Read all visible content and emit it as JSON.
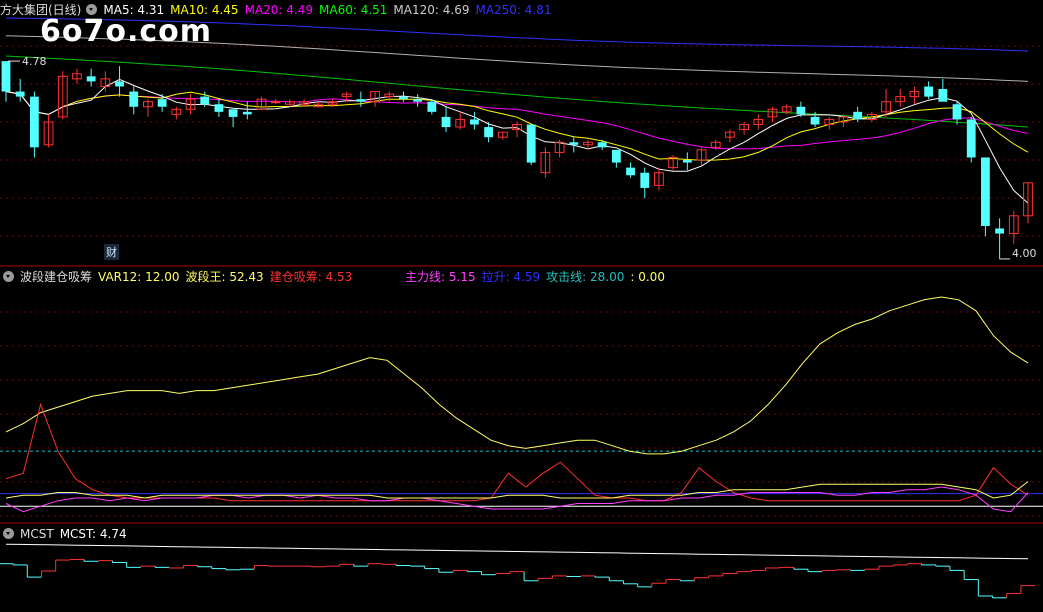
{
  "watermark": "6o7o.com",
  "panel1": {
    "title": "方大集团(日线)",
    "ma": [
      {
        "label": "MA5: 4.31",
        "color": "#ffffff"
      },
      {
        "label": "MA10: 4.45",
        "color": "#ffff00"
      },
      {
        "label": "MA20: 4.49",
        "color": "#ff00ff"
      },
      {
        "label": "MA60: 4.51",
        "color": "#00ff00"
      },
      {
        "label": "MA120: 4.69",
        "color": "#cccccc"
      },
      {
        "label": "MA250: 4.81",
        "color": "#3030ff"
      }
    ],
    "high_label": "4.78",
    "low_label": "4.00",
    "event_label": "财"
  },
  "panel2": {
    "title": "波段建仓吸筹",
    "items": [
      {
        "label": "VAR12: 12.00",
        "color": "#ffff66"
      },
      {
        "label": "波段王: 52.43",
        "color": "#ffff66"
      },
      {
        "label": "建仓吸筹: 4.53",
        "color": "#ff3030"
      }
    ],
    "items2": [
      {
        "label": "主力线: 5.15",
        "color": "#ff40ff"
      },
      {
        "label": "拉升: 4.59",
        "color": "#3030ff"
      },
      {
        "label": "攻击线: 28.00",
        "color": "#20c0c0"
      },
      {
        "label": ": 0.00",
        "color": "#ffff66"
      }
    ]
  },
  "panel3": {
    "title": "MCST",
    "items": [
      {
        "label": "MCST: 4.74",
        "color": "#ffffff"
      }
    ]
  },
  "colors": {
    "up": "#ff3232",
    "down": "#54ffff",
    "separator": "#b00000",
    "grid": "#7a0000"
  },
  "chart_data": [
    {
      "type": "candlestick",
      "title": "方大集团(日线)",
      "ylim": [
        3.98,
        4.95
      ],
      "candles": [
        [
          4.78,
          4.78,
          4.62,
          4.66
        ],
        [
          4.66,
          4.71,
          4.62,
          4.64
        ],
        [
          4.64,
          4.66,
          4.4,
          4.44
        ],
        [
          4.45,
          4.57,
          4.44,
          4.54
        ],
        [
          4.56,
          4.74,
          4.55,
          4.72
        ],
        [
          4.71,
          4.75,
          4.69,
          4.73
        ],
        [
          4.72,
          4.75,
          4.68,
          4.7
        ],
        [
          4.68,
          4.74,
          4.66,
          4.71
        ],
        [
          4.7,
          4.76,
          4.64,
          4.68
        ],
        [
          4.66,
          4.68,
          4.57,
          4.6
        ],
        [
          4.6,
          4.63,
          4.56,
          4.62
        ],
        [
          4.63,
          4.65,
          4.58,
          4.6
        ],
        [
          4.57,
          4.6,
          4.55,
          4.59
        ],
        [
          4.59,
          4.65,
          4.57,
          4.63
        ],
        [
          4.64,
          4.66,
          4.6,
          4.61
        ],
        [
          4.61,
          4.63,
          4.56,
          4.58
        ],
        [
          4.59,
          4.59,
          4.52,
          4.56
        ],
        [
          4.58,
          4.62,
          4.55,
          4.57
        ],
        [
          4.59,
          4.64,
          4.59,
          4.63
        ],
        [
          4.62,
          4.63,
          4.61,
          4.62
        ],
        [
          4.61,
          4.63,
          4.6,
          4.62
        ],
        [
          4.61,
          4.63,
          4.6,
          4.62
        ],
        [
          4.6,
          4.62,
          4.6,
          4.61
        ],
        [
          4.61,
          4.63,
          4.6,
          4.62
        ],
        [
          4.64,
          4.66,
          4.62,
          4.65
        ],
        [
          4.63,
          4.66,
          4.6,
          4.62
        ],
        [
          4.62,
          4.66,
          4.6,
          4.66
        ],
        [
          4.64,
          4.66,
          4.62,
          4.65
        ],
        [
          4.64,
          4.66,
          4.62,
          4.63
        ],
        [
          4.63,
          4.65,
          4.6,
          4.62
        ],
        [
          4.62,
          4.63,
          4.57,
          4.58
        ],
        [
          4.56,
          4.6,
          4.5,
          4.52
        ],
        [
          4.52,
          4.58,
          4.51,
          4.55
        ],
        [
          4.55,
          4.58,
          4.51,
          4.53
        ],
        [
          4.52,
          4.54,
          4.46,
          4.48
        ],
        [
          4.48,
          4.5,
          4.47,
          4.5
        ],
        [
          4.51,
          4.54,
          4.48,
          4.53
        ],
        [
          4.53,
          4.53,
          4.37,
          4.38
        ],
        [
          4.34,
          4.44,
          4.32,
          4.42
        ],
        [
          4.42,
          4.47,
          4.4,
          4.46
        ],
        [
          4.46,
          4.48,
          4.42,
          4.45
        ],
        [
          4.45,
          4.47,
          4.43,
          4.46
        ],
        [
          4.46,
          4.47,
          4.43,
          4.44
        ],
        [
          4.43,
          4.43,
          4.36,
          4.38
        ],
        [
          4.36,
          4.38,
          4.32,
          4.33
        ],
        [
          4.34,
          4.36,
          4.24,
          4.28
        ],
        [
          4.29,
          4.36,
          4.27,
          4.34
        ],
        [
          4.36,
          4.41,
          4.35,
          4.4
        ],
        [
          4.39,
          4.42,
          4.35,
          4.38
        ],
        [
          4.39,
          4.44,
          4.37,
          4.43
        ],
        [
          4.44,
          4.47,
          4.43,
          4.46
        ],
        [
          4.48,
          4.51,
          4.46,
          4.5
        ],
        [
          4.51,
          4.54,
          4.49,
          4.53
        ],
        [
          4.53,
          4.57,
          4.51,
          4.55
        ],
        [
          4.56,
          4.6,
          4.54,
          4.59
        ],
        [
          4.58,
          4.61,
          4.57,
          4.6
        ],
        [
          4.6,
          4.62,
          4.56,
          4.57
        ],
        [
          4.56,
          4.58,
          4.52,
          4.53
        ],
        [
          4.53,
          4.56,
          4.51,
          4.55
        ],
        [
          4.54,
          4.57,
          4.52,
          4.56
        ],
        [
          4.58,
          4.6,
          4.54,
          4.55
        ],
        [
          4.55,
          4.58,
          4.54,
          4.57
        ],
        [
          4.58,
          4.67,
          4.56,
          4.62
        ],
        [
          4.62,
          4.67,
          4.6,
          4.64
        ],
        [
          4.64,
          4.68,
          4.61,
          4.66
        ],
        [
          4.68,
          4.7,
          4.63,
          4.64
        ],
        [
          4.67,
          4.71,
          4.63,
          4.62
        ],
        [
          4.61,
          4.62,
          4.53,
          4.55
        ],
        [
          4.55,
          4.56,
          4.38,
          4.4
        ],
        [
          4.4,
          4.4,
          4.09,
          4.13
        ],
        [
          4.12,
          4.16,
          4.0,
          4.1
        ],
        [
          4.1,
          4.19,
          4.06,
          4.17
        ],
        [
          4.17,
          4.3,
          4.14,
          4.3
        ]
      ],
      "ma5_end": 4.31,
      "ma10_end": 4.45,
      "ma20_end": 4.49,
      "ma60_end": 4.51,
      "ma120_end": 4.69,
      "ma250_end": 4.81
    },
    {
      "type": "line",
      "title": "波段建仓吸筹",
      "ylim": [
        -5,
        80
      ],
      "series": [
        {
          "name": "波段王",
          "values": [
            27,
            30,
            34,
            36,
            38,
            40,
            41,
            42,
            42,
            42,
            41,
            42,
            42,
            43,
            44,
            45,
            46,
            47,
            48,
            50,
            52,
            54,
            53,
            48,
            43,
            37,
            32,
            28,
            24,
            22,
            21,
            22,
            23,
            24,
            24,
            22,
            20,
            19,
            19,
            20,
            22,
            24,
            27,
            31,
            37,
            44,
            52,
            59,
            63,
            66,
            68,
            71,
            73,
            75,
            76,
            75,
            71,
            62,
            56,
            52
          ]
        },
        {
          "name": "建仓吸筹",
          "values": [
            10,
            12,
            37,
            20,
            10,
            6,
            4,
            3,
            3,
            3,
            3,
            3,
            3,
            2,
            2,
            2,
            2,
            2,
            2,
            2,
            2,
            2,
            2,
            2,
            2,
            2,
            2,
            2,
            3,
            12,
            7,
            12,
            16,
            10,
            4,
            3,
            3,
            2,
            2,
            5,
            14,
            9,
            5,
            3,
            2,
            2,
            2,
            2,
            2,
            2,
            2,
            2,
            2,
            2,
            2,
            2,
            4,
            14,
            8,
            4
          ]
        },
        {
          "name": "主力线",
          "values": [
            1,
            -2,
            0,
            2,
            3,
            3,
            2,
            3,
            2,
            3,
            3,
            3,
            4,
            4,
            3,
            4,
            4,
            3,
            4,
            3,
            3,
            2,
            2,
            3,
            3,
            2,
            1,
            0,
            -1,
            -1,
            -1,
            -1,
            0,
            1,
            1,
            1,
            2,
            2,
            2,
            3,
            3,
            4,
            4,
            5,
            5,
            5,
            5,
            5,
            4,
            4,
            5,
            5,
            6,
            6,
            7,
            6,
            4,
            -1,
            -2,
            5
          ]
        },
        {
          "name": "攻击线",
          "values": [
            3,
            4,
            4,
            5,
            5,
            4,
            4,
            4,
            3,
            4,
            4,
            4,
            4,
            4,
            4,
            4,
            4,
            4,
            4,
            4,
            4,
            4,
            3,
            3,
            3,
            3,
            3,
            3,
            3,
            4,
            4,
            4,
            3,
            3,
            3,
            3,
            4,
            4,
            4,
            4,
            5,
            5,
            6,
            6,
            6,
            6,
            7,
            8,
            8,
            8,
            8,
            8,
            8,
            8,
            8,
            7,
            6,
            3,
            4,
            9
          ]
        }
      ],
      "threshold": 20
    },
    {
      "type": "step",
      "title": "MCST",
      "ylim": [
        3.9,
        5.0
      ],
      "mcst_end": 4.74
    }
  ]
}
